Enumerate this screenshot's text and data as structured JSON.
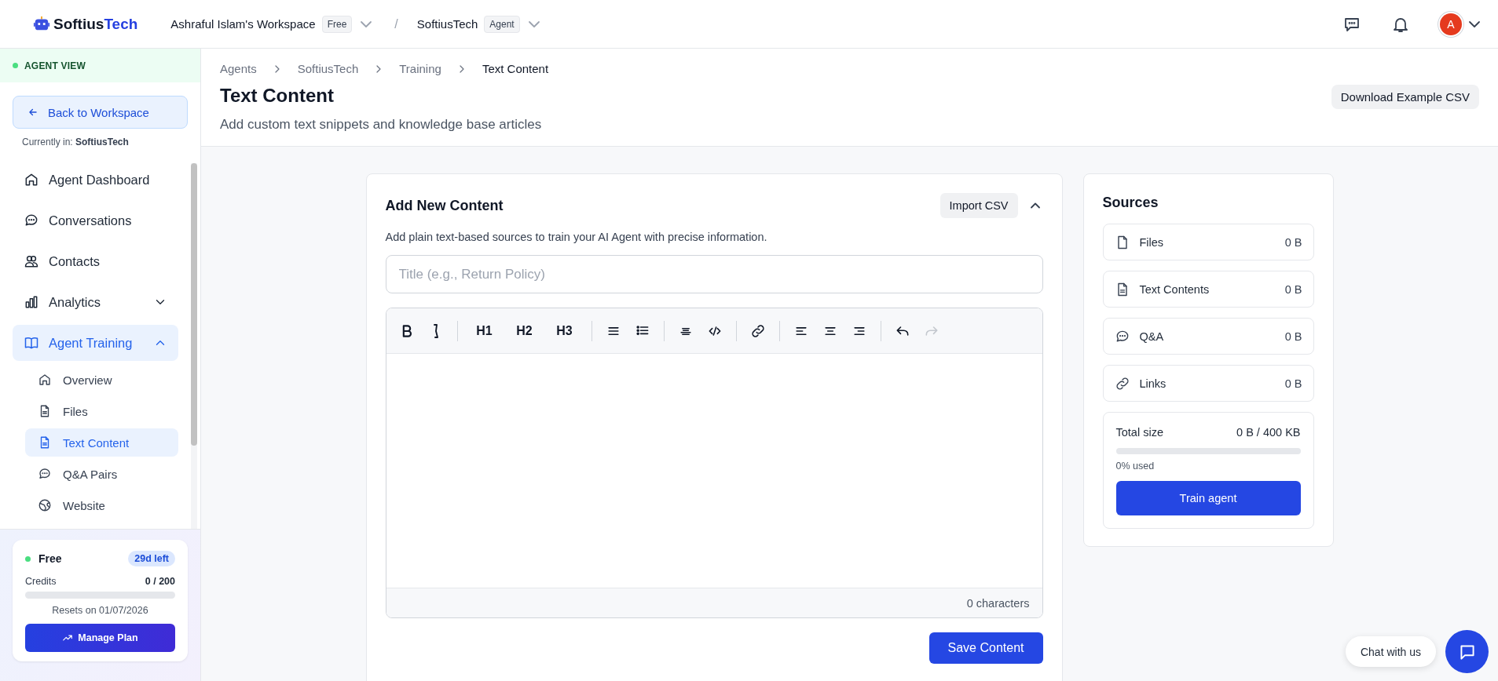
{
  "topbar": {
    "brand": {
      "part1": "Softius",
      "part2": "Tech"
    },
    "workspace": {
      "name": "Ashraful Islam's Workspace",
      "badge": "Free"
    },
    "separator": "/",
    "agent": {
      "name": "SoftiusTech",
      "badge": "Agent"
    },
    "avatar": "A"
  },
  "sidebar": {
    "mode": "AGENT VIEW",
    "back": "Back to Workspace",
    "current_label": "Currently in:",
    "current_value": "SoftiusTech",
    "items": [
      {
        "label": "Agent Dashboard",
        "selected": false
      },
      {
        "label": "Conversations",
        "selected": false
      },
      {
        "label": "Contacts",
        "selected": false
      },
      {
        "label": "Analytics",
        "selected": false,
        "expanded": false
      },
      {
        "label": "Agent Training",
        "selected": true,
        "expanded": true,
        "children": [
          {
            "label": "Overview",
            "selected": false
          },
          {
            "label": "Files",
            "selected": false
          },
          {
            "label": "Text Content",
            "selected": true
          },
          {
            "label": "Q&A Pairs",
            "selected": false
          },
          {
            "label": "Website",
            "selected": false
          }
        ]
      }
    ],
    "plan": {
      "name": "Free",
      "days": "29d left",
      "credits_label": "Credits",
      "credits": "0 / 200",
      "level": 0,
      "resets": "Resets on 01/07/2026",
      "button": "Manage Plan"
    }
  },
  "breadcrumb": [
    {
      "label": "Agents",
      "current": false
    },
    {
      "label": "SoftiusTech",
      "current": false
    },
    {
      "label": "Training",
      "current": false
    },
    {
      "label": "Text Content",
      "current": true
    }
  ],
  "header": {
    "title": "Text Content",
    "subtitle": "Add custom text snippets and knowledge base articles",
    "action": "Download Example CSV"
  },
  "editor_card": {
    "title": "Add New Content",
    "import": "Import CSV",
    "expanded": true,
    "description": "Add plain text-based sources to train your AI Agent with precise information.",
    "title_field": {
      "placeholder": "Title (e.g., Return Policy)"
    },
    "toolbar": [
      [
        {
          "kind": "bold",
          "disabled": false
        },
        {
          "kind": "italic",
          "disabled": false
        }
      ],
      [
        {
          "kind": "heading",
          "label": "H1",
          "disabled": false
        },
        {
          "kind": "heading",
          "label": "H2",
          "disabled": false
        },
        {
          "kind": "heading",
          "label": "H3",
          "disabled": false
        }
      ],
      [
        {
          "kind": "bullets",
          "disabled": false
        },
        {
          "kind": "numbered",
          "disabled": false
        }
      ],
      [
        {
          "kind": "blockquote",
          "disabled": false
        },
        {
          "kind": "code",
          "disabled": false
        }
      ],
      [
        {
          "kind": "link",
          "disabled": false
        }
      ],
      [
        {
          "kind": "align-left",
          "disabled": false
        },
        {
          "kind": "align-center",
          "disabled": false
        },
        {
          "kind": "align-right",
          "disabled": false
        }
      ],
      [
        {
          "kind": "undo",
          "disabled": false
        },
        {
          "kind": "redo",
          "disabled": true
        }
      ]
    ],
    "char_count": "0 characters",
    "save": "Save Content"
  },
  "sources": {
    "title": "Sources",
    "items": [
      {
        "label": "Files",
        "size": "0 B"
      },
      {
        "label": "Text Contents",
        "size": "0 B"
      },
      {
        "label": "Q&A",
        "size": "0 B"
      },
      {
        "label": "Links",
        "size": "0 B"
      }
    ],
    "total_label": "Total size",
    "total_value": "0 B / 400 KB",
    "level": 0,
    "used": "0% used",
    "button": "Train agent"
  },
  "chat": {
    "label": "Chat with us"
  }
}
